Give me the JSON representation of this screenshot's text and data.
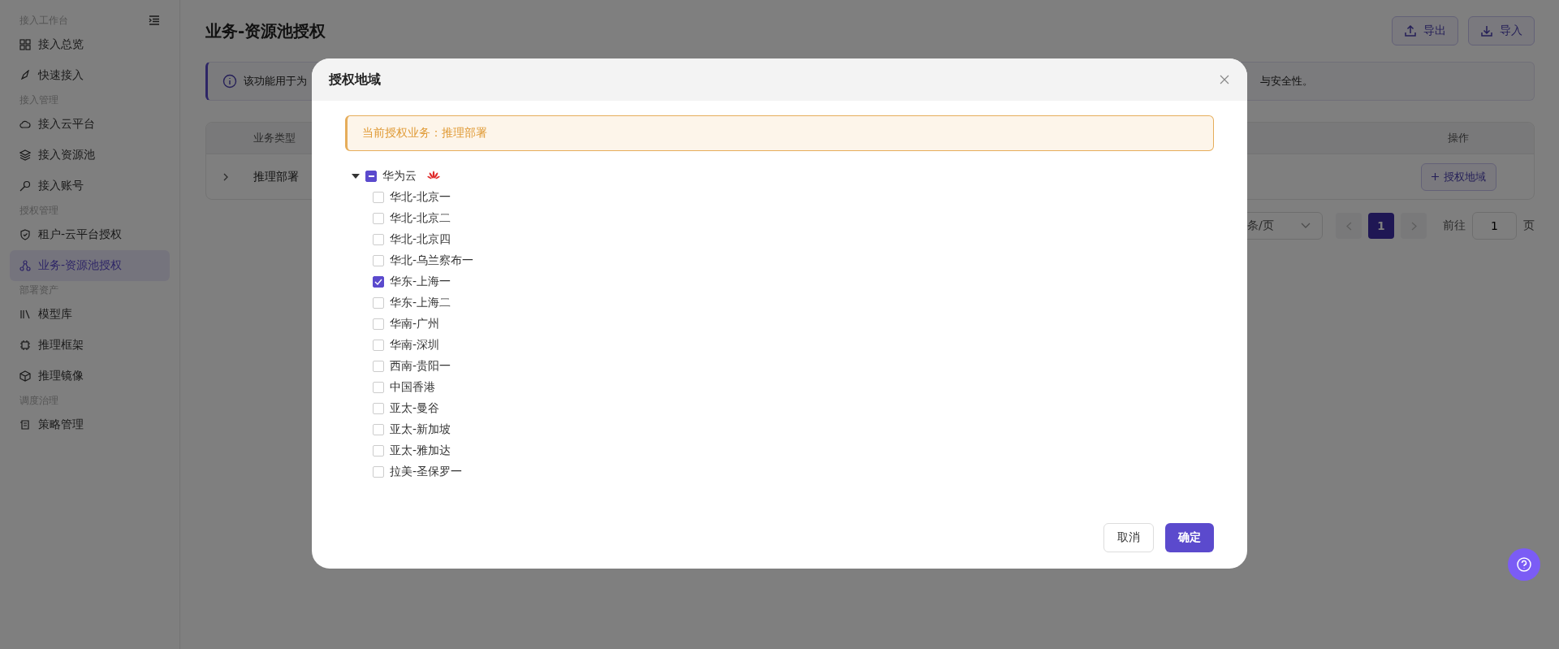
{
  "sidebar": {
    "groups": [
      {
        "label": "接入工作台",
        "items": [
          {
            "label": "接入总览",
            "selected": false
          },
          {
            "label": "快速接入",
            "selected": false
          }
        ]
      },
      {
        "label": "接入管理",
        "items": [
          {
            "label": "接入云平台",
            "selected": false
          },
          {
            "label": "接入资源池",
            "selected": false
          },
          {
            "label": "接入账号",
            "selected": false
          }
        ]
      },
      {
        "label": "授权管理",
        "items": [
          {
            "label": "租户-云平台授权",
            "selected": false
          },
          {
            "label": "业务-资源池授权",
            "selected": true
          }
        ]
      },
      {
        "label": "部署资产",
        "items": [
          {
            "label": "模型库",
            "selected": false
          },
          {
            "label": "推理框架",
            "selected": false
          },
          {
            "label": "推理镜像",
            "selected": false
          }
        ]
      },
      {
        "label": "调度治理",
        "items": [
          {
            "label": "策略管理",
            "selected": false
          }
        ]
      }
    ]
  },
  "page": {
    "title": "业务-资源池授权",
    "buttons": [
      {
        "kind": "export",
        "label": "导出"
      },
      {
        "kind": "import",
        "label": "导入"
      }
    ],
    "info": {
      "text_start": "该功能用于为",
      "text_end": "与安全性。"
    },
    "table": {
      "columns": [
        "业务类型",
        "操作"
      ],
      "rows": [
        {
          "expanded": false,
          "cells": [
            "推理部署"
          ],
          "action": "授权地域"
        }
      ]
    },
    "pagination": {
      "page_size": "条/页",
      "pages": [
        {
          "label": "1",
          "selected": true
        }
      ],
      "goto_label": "前往",
      "goto_value": "1",
      "goto_suffix": "页"
    }
  },
  "dialog": {
    "title": "授权地域",
    "notice": "当前授权业务：推理部署",
    "tree": [
      {
        "label": "华为云",
        "expanded": true,
        "indeterminate": true,
        "children": [
          {
            "label": "华北-北京一",
            "checked": false
          },
          {
            "label": "华北-北京二",
            "checked": false
          },
          {
            "label": "华北-北京四",
            "checked": false
          },
          {
            "label": "华北-乌兰察布一",
            "checked": false
          },
          {
            "label": "华东-上海一",
            "checked": true
          },
          {
            "label": "华东-上海二",
            "checked": false
          },
          {
            "label": "华南-广州",
            "checked": false
          },
          {
            "label": "华南-深圳",
            "checked": false
          },
          {
            "label": "西南-贵阳一",
            "checked": false
          },
          {
            "label": "中国香港",
            "checked": false
          },
          {
            "label": "亚太-曼谷",
            "checked": false
          },
          {
            "label": "亚太-新加坡",
            "checked": false
          },
          {
            "label": "亚太-雅加达",
            "checked": false
          },
          {
            "label": "拉美-圣保罗一",
            "checked": false
          }
        ]
      }
    ],
    "buttons": [
      {
        "kind": "secondary",
        "label": "取消"
      },
      {
        "kind": "primary",
        "label": "确定"
      }
    ]
  }
}
